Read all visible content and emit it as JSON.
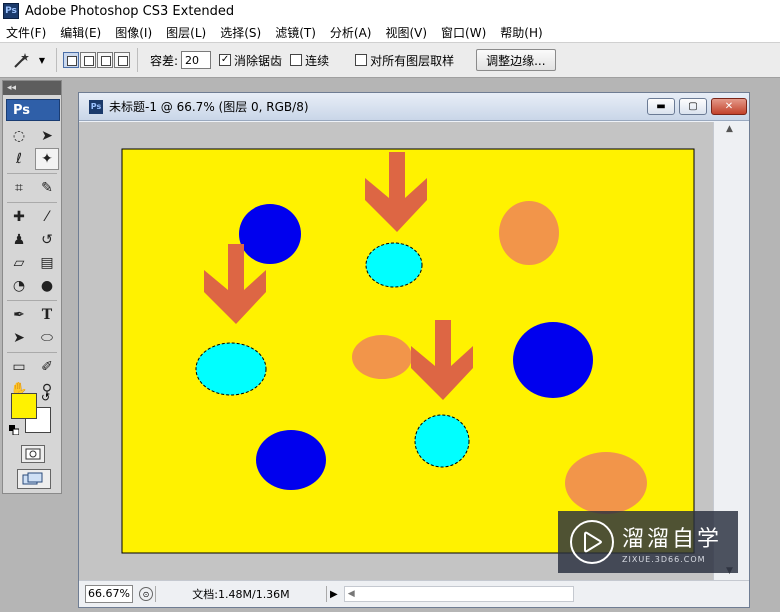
{
  "app": {
    "title": "Adobe Photoshop CS3 Extended",
    "icon": "Ps"
  },
  "menu": [
    "文件(F)",
    "编辑(E)",
    "图像(I)",
    "图层(L)",
    "选择(S)",
    "滤镜(T)",
    "分析(A)",
    "视图(V)",
    "窗口(W)",
    "帮助(H)"
  ],
  "options": {
    "tool_icon": "magic-wand-icon",
    "tolerance_label": "容差:",
    "tolerance_value": "20",
    "antialias_label": "消除锯齿",
    "antialias_checked": true,
    "contiguous_label": "连续",
    "contiguous_checked": false,
    "sample_all_label": "对所有图层取样",
    "sample_all_checked": false,
    "refine_edge_label": "调整边缘..."
  },
  "toolbox": {
    "logo": "Ps",
    "foreground_color": "#fff200",
    "background_color": "#ffffff",
    "tools": [
      [
        "marquee-icon",
        "move-icon"
      ],
      [
        "lasso-icon",
        "magic-wand-icon"
      ],
      [
        "crop-icon",
        "slice-icon"
      ],
      [
        "healing-brush-icon",
        "brush-icon"
      ],
      [
        "clone-stamp-icon",
        "history-brush-icon"
      ],
      [
        "eraser-icon",
        "gradient-icon"
      ],
      [
        "blur-icon",
        "dodge-icon"
      ],
      [
        "pen-icon",
        "type-icon"
      ],
      [
        "path-selection-icon",
        "shape-icon"
      ],
      [
        "notes-icon",
        "eyedropper-icon"
      ],
      [
        "hand-icon",
        "zoom-icon"
      ]
    ]
  },
  "document": {
    "title": "未标题-1 @ 66.7% (图层 0, RGB/8)",
    "zoom": "66.67%",
    "doc_info": "文档:1.48M/1.36M",
    "canvas_color": "#fff200",
    "shapes": {
      "blue": "#0000ee",
      "cyan": "#00ffff",
      "orange": "#f2954a",
      "arrow": "#dd6644"
    }
  },
  "watermark": {
    "title": "溜溜自学",
    "url": "ZIXUE.3D66.COM"
  }
}
